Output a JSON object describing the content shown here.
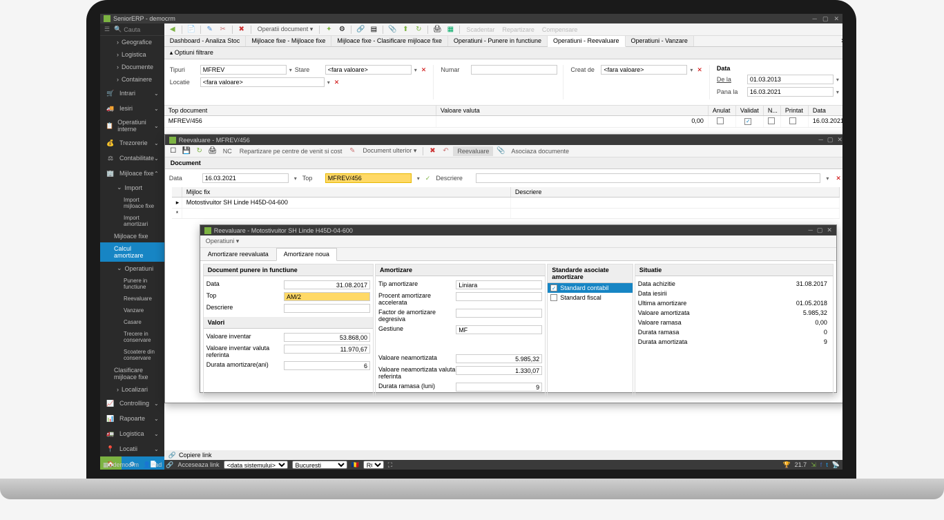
{
  "app": {
    "title": "SeniorERP - democrm"
  },
  "search": {
    "placeholder": "Cauta"
  },
  "sidebar": {
    "top_groups": [
      "Geografice",
      "Logistica",
      "Documente",
      "Containere"
    ],
    "menus": [
      {
        "label": "Intrari",
        "icon": "🛒"
      },
      {
        "label": "Iesiri",
        "icon": "🚚"
      },
      {
        "label": "Operatiuni interne",
        "icon": "📋"
      },
      {
        "label": "Trezorerie",
        "icon": "📊"
      },
      {
        "label": "Contabilitate",
        "icon": "⚖"
      }
    ],
    "mf": {
      "label": "Mijloace fixe",
      "import_label": "Import",
      "import_items": [
        "Import mijloace fixe",
        "Import amortizari"
      ],
      "direct_items": [
        "Mijloace fixe",
        "Calcul amortizare"
      ],
      "operatiuni_label": "Operatiuni",
      "operatiuni_items": [
        "Punere in functiune",
        "Reevaluare",
        "Vanzare",
        "Casare",
        "Trecere in conservare",
        "Scoatere din conservare"
      ],
      "tail_items": [
        "Clasificare mijloace fixe",
        "Localizari"
      ]
    },
    "bottom_menus": [
      {
        "label": "Controlling",
        "icon": "📈"
      },
      {
        "label": "Rapoarte",
        "icon": "📊"
      },
      {
        "label": "Logistica",
        "icon": "🚛"
      },
      {
        "label": "Locatii",
        "icon": "📍"
      }
    ]
  },
  "toolbar": {
    "back": "←",
    "doc": "📄",
    "edit": "✎",
    "cut": "✂",
    "del": "✖",
    "ops_label": "Operatii document",
    "actions_disabled": [
      "Scadentar",
      "Repartizare",
      "Compensare"
    ]
  },
  "tabs": [
    "Dashboard - Analiza Stoc",
    "Mijloace fixe - Mijloace fixe",
    "Mijloace fixe - Clasificare mijloace fixe",
    "Operatiuni - Punere in functiune",
    "Operatiuni - Reevaluare",
    "Operatiuni - Vanzare"
  ],
  "active_tab_index": 4,
  "filter": {
    "title": "Optiuni filtrare",
    "tipuri_label": "Tipuri",
    "tipuri_value": "MFREV",
    "locatie_label": "Locatie",
    "locatie_value": "<fara valoare>",
    "stare_label": "Stare",
    "stare_value": "<fara valoare>",
    "numar_label": "Numar",
    "creat_label": "Creat de",
    "creat_value": "<fara valoare>",
    "data_label": "Data",
    "dela_label": "De la",
    "dela_value": "01.03.2013",
    "panala_label": "Pana la",
    "panala_value": "16.03.2021"
  },
  "grid": {
    "cols": [
      "Top document",
      "Valoare valuta",
      "Anulat",
      "Validat",
      "N...",
      "Printat",
      "Data"
    ],
    "row": {
      "doc": "MFREV/456",
      "val": "0,00",
      "validat": true,
      "data": "16.03.2021"
    }
  },
  "subwin1": {
    "title": "Reevaluare - MFREV/456",
    "nc": "NC",
    "repart": "Repartizare pe centre de venit si cost",
    "doc_ult": "Document ulterior",
    "reev_btn": "Reevaluare",
    "asoc": "Asociaza documente",
    "doc_header": "Document",
    "data_label": "Data",
    "data_value": "16.03.2021",
    "top_label": "Top",
    "top_value": "MFREV/456",
    "descr_label": "Descriere",
    "mijloc_header": "Mijloc fix",
    "descr_header": "Descriere",
    "mijloc_value": "Motostivuitor SH Linde H45D-04-600"
  },
  "subwin2": {
    "title": "Reevaluare - Motostivuitor SH Linde H45D-04-600",
    "ops": "Operatiuni",
    "tabs": [
      "Amortizare reevaluata",
      "Amortizare noua"
    ],
    "doc_panel": {
      "header": "Document punere in functiune",
      "rows": [
        {
          "l": "Data",
          "v": "31.08.2017"
        },
        {
          "l": "Top",
          "v": "AM/2",
          "hl": true
        },
        {
          "l": "Descriere",
          "v": ""
        }
      ],
      "valori_header": "Valori",
      "valori": [
        {
          "l": "Valoare inventar",
          "v": "53.868,00"
        },
        {
          "l": "Valoare inventar valuta referinta",
          "v": "11.970,67"
        },
        {
          "l": "Durata amortizare(ani)",
          "v": "6"
        }
      ]
    },
    "amort_panel": {
      "header": "Amortizare",
      "rows": [
        {
          "l": "Tip amortizare",
          "v": "Liniara"
        },
        {
          "l": "Procent amortizare accelerata",
          "v": ""
        },
        {
          "l": "Factor de amortizare degresiva",
          "v": ""
        },
        {
          "l": "Gestiune",
          "v": "MF"
        }
      ],
      "valori": [
        {
          "l": "Valoare neamortizata",
          "v": "5.985,32"
        },
        {
          "l": "Valoare neamortizata valuta referinta",
          "v": "1.330,07"
        },
        {
          "l": "Durata ramasa (luni)",
          "v": "9"
        }
      ]
    },
    "std_panel": {
      "header": "Standarde asociate amortizare",
      "items": [
        {
          "label": "Standard contabil",
          "checked": true
        },
        {
          "label": "Standard fiscal",
          "checked": false
        }
      ]
    },
    "sit_panel": {
      "header": "Situatie",
      "rows": [
        {
          "l": "Data achizitie",
          "v": "31.08.2017"
        },
        {
          "l": "Data iesirii",
          "v": ""
        },
        {
          "l": "Ultima amortizare",
          "v": "01.05.2018"
        },
        {
          "l": "Valoare amortizata",
          "v": "5.985,32"
        },
        {
          "l": "Valoare ramasa",
          "v": "0,00"
        },
        {
          "l": "Durata ramasa",
          "v": "0"
        },
        {
          "l": "Durata amortizata",
          "v": "9"
        }
      ]
    }
  },
  "copiere": {
    "label": "Copiere link"
  },
  "statusbar": {
    "tenant": "democrm",
    "user": "ad",
    "link": "Acceseaza link",
    "data_sys": "<data sistemului>",
    "city": "Bucuresti",
    "lang": "RO",
    "version": "21.7"
  }
}
